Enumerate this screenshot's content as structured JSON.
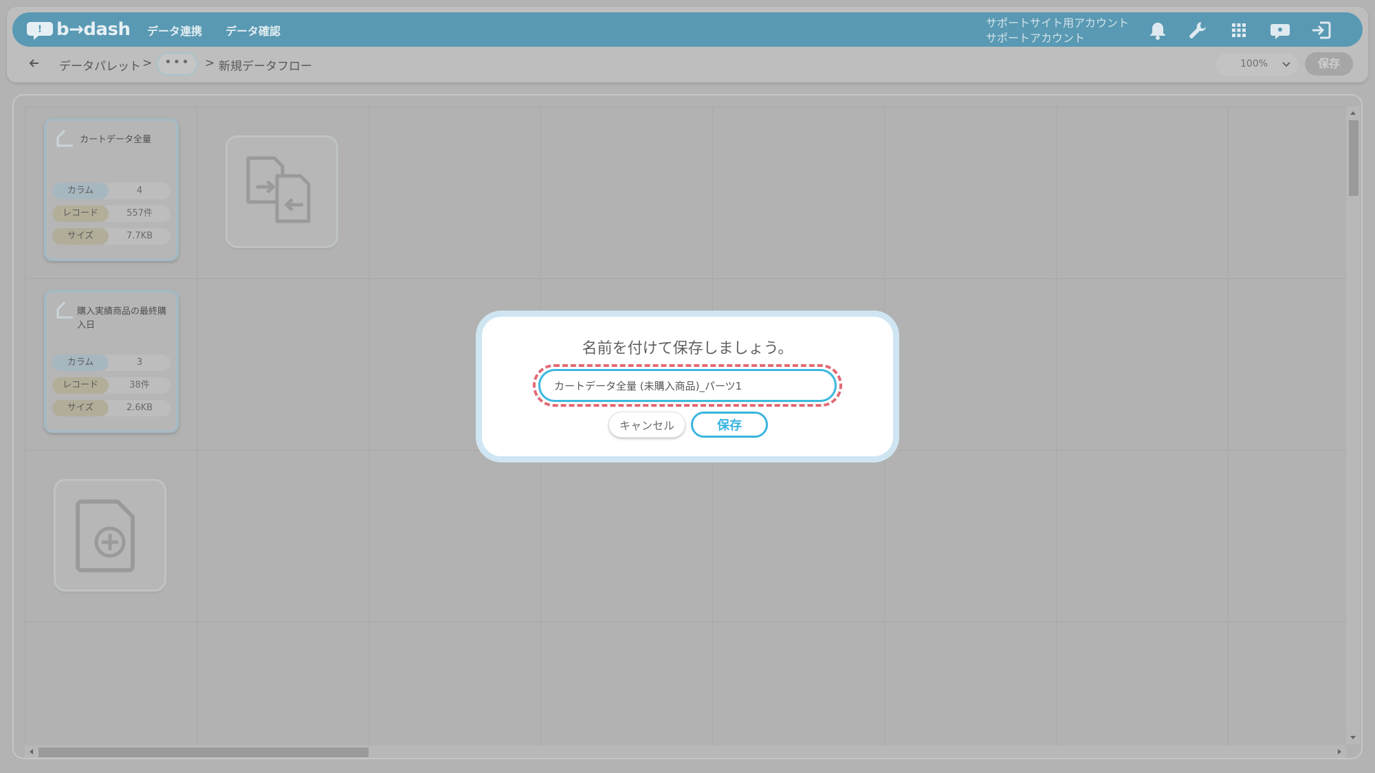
{
  "header": {
    "logo_text": "b→dash",
    "nav": [
      "データ連携",
      "データ確認"
    ],
    "account_line1": "サポートサイト用アカウント",
    "account_line2": "サポートアカウント",
    "icons": [
      "bell-icon",
      "wrench-icon",
      "apps-grid-icon",
      "chat-support-icon",
      "logout-icon"
    ],
    "accent_color": "#5999b3"
  },
  "subbar": {
    "breadcrumb_root": "データパレット",
    "sep1": ">",
    "ellipsis": "•••",
    "sep2": ">",
    "current": "新規データフロー",
    "zoom_value": "100%",
    "save_label": "保存"
  },
  "canvas": {
    "cards": [
      {
        "title": "カートデータ全量",
        "stats": [
          {
            "label": "カラム",
            "value": "4"
          },
          {
            "label": "レコード",
            "value": "557件"
          },
          {
            "label": "サイズ",
            "value": "7.7KB"
          }
        ]
      },
      {
        "title": "購入実績商品の最終購入日",
        "stats": [
          {
            "label": "カラム",
            "value": "3"
          },
          {
            "label": "レコード",
            "value": "38件"
          },
          {
            "label": "サイズ",
            "value": "2.6KB"
          }
        ]
      }
    ]
  },
  "dialog": {
    "title": "名前を付けて保存しましょう。",
    "input_value": "カートデータ全量 (未購入商品)_パーツ1",
    "cancel_label": "キャンセル",
    "save_label": "保存",
    "highlight_color": "#e26a75",
    "primary_color": "#38b4e0"
  }
}
